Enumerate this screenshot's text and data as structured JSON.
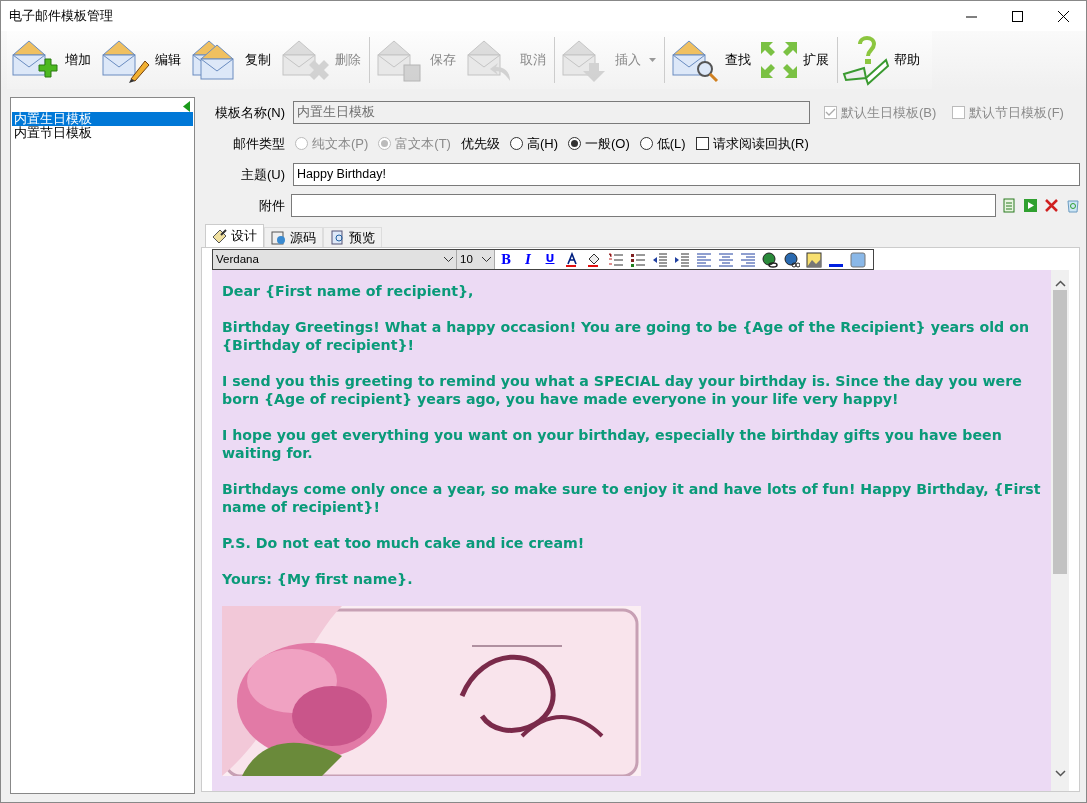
{
  "window": {
    "title": "电子邮件模板管理"
  },
  "toolbar": [
    {
      "label": "增加",
      "disabled": false,
      "kind": "button"
    },
    {
      "label": "编辑",
      "disabled": false,
      "kind": "button"
    },
    {
      "label": "复制",
      "disabled": false,
      "kind": "button"
    },
    {
      "label": "删除",
      "disabled": true,
      "kind": "button"
    },
    {
      "label": "保存",
      "disabled": true,
      "kind": "button"
    },
    {
      "label": "取消",
      "disabled": true,
      "kind": "button"
    },
    {
      "label": "插入",
      "disabled": true,
      "kind": "dropdown"
    },
    {
      "label": "查找",
      "disabled": false,
      "kind": "button"
    },
    {
      "label": "扩展",
      "disabled": false,
      "kind": "button"
    },
    {
      "label": "帮助",
      "disabled": false,
      "kind": "button"
    }
  ],
  "templates": [
    {
      "label": "内置生日模板",
      "selected": true
    },
    {
      "label": "内置节日模板",
      "selected": false
    }
  ],
  "form": {
    "name_label": "模板名称(N)",
    "name_value": "内置生日模板",
    "name_disabled": true,
    "default_birthday": {
      "label": "默认生日模板(B)",
      "checked": true,
      "disabled": true
    },
    "default_holiday": {
      "label": "默认节日模板(F)",
      "checked": false,
      "disabled": true
    },
    "mail_type_label": "邮件类型",
    "mail_types": [
      {
        "label": "纯文本(P)",
        "selected": false,
        "disabled": true
      },
      {
        "label": "富文本(T)",
        "selected": true,
        "disabled": true
      }
    ],
    "priority_label": "优先级",
    "priorities": [
      {
        "label": "高(H)",
        "selected": false
      },
      {
        "label": "一般(O)",
        "selected": true
      },
      {
        "label": "低(L)",
        "selected": false
      }
    ],
    "read_receipt": {
      "label": "请求阅读回执(R)",
      "checked": false
    },
    "subject_label": "主题(U)",
    "subject_value": "Happy Birthday!",
    "attachment_label": "附件"
  },
  "tabs": [
    {
      "label": "设计",
      "selected": true
    },
    {
      "label": "源码",
      "selected": false
    },
    {
      "label": "预览",
      "selected": false
    }
  ],
  "editor": {
    "font": "Verdana",
    "size": "10",
    "format_buttons": [
      "B",
      "I",
      "U"
    ],
    "paragraphs": [
      "Dear {First name of recipient},",
      "Birthday Greetings! What a happy occasion! You are going to be {Age of the Recipient} years old on {Birthday of recipient}!",
      "I send you this greeting to remind you what a SPECIAL day your birthday is. Since the day you were born {Age of recipient} years ago, you have made everyone in your life very happy!",
      "I hope you get everything you want on your birthday, especially the birthday gifts you have been waiting for.",
      "Birthdays come only once a year, so make sure to enjoy it and have lots of fun! Happy Birthday, {First name of recipient}!",
      "P.S. Do not eat too much cake and ice cream!",
      "Yours: {My first name}."
    ]
  }
}
